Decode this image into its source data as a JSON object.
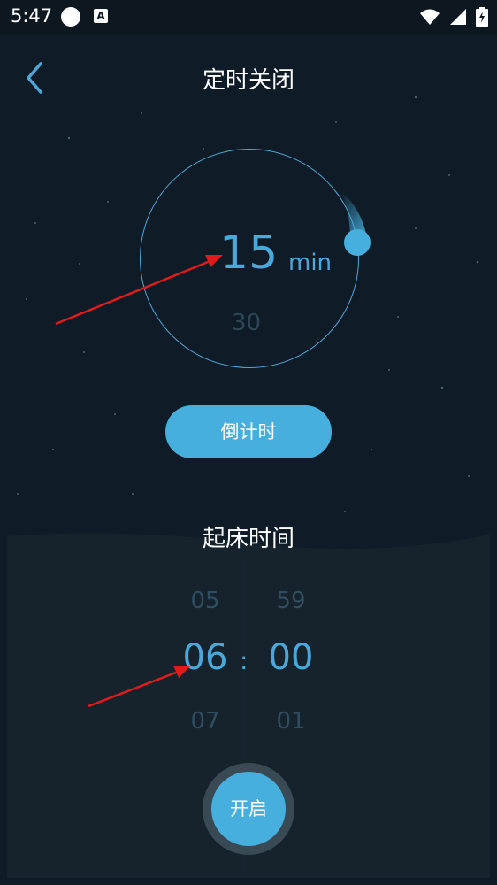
{
  "status_bar": {
    "time": "5:47"
  },
  "header": {
    "title": "定时关闭"
  },
  "timer": {
    "value": "15",
    "unit": "min",
    "next_value": "30"
  },
  "countdown_button": {
    "label": "倒计时"
  },
  "alarm": {
    "title": "起床时间",
    "hours": {
      "prev": "05",
      "selected": "06",
      "next": "07"
    },
    "minutes": {
      "prev": "59",
      "selected": "00",
      "next": "01"
    },
    "separator": ":"
  },
  "start_button": {
    "label": "开启"
  },
  "colors": {
    "accent": "#46afde",
    "background": "#0f1c27",
    "annotation_arrow": "#e01b1b"
  }
}
